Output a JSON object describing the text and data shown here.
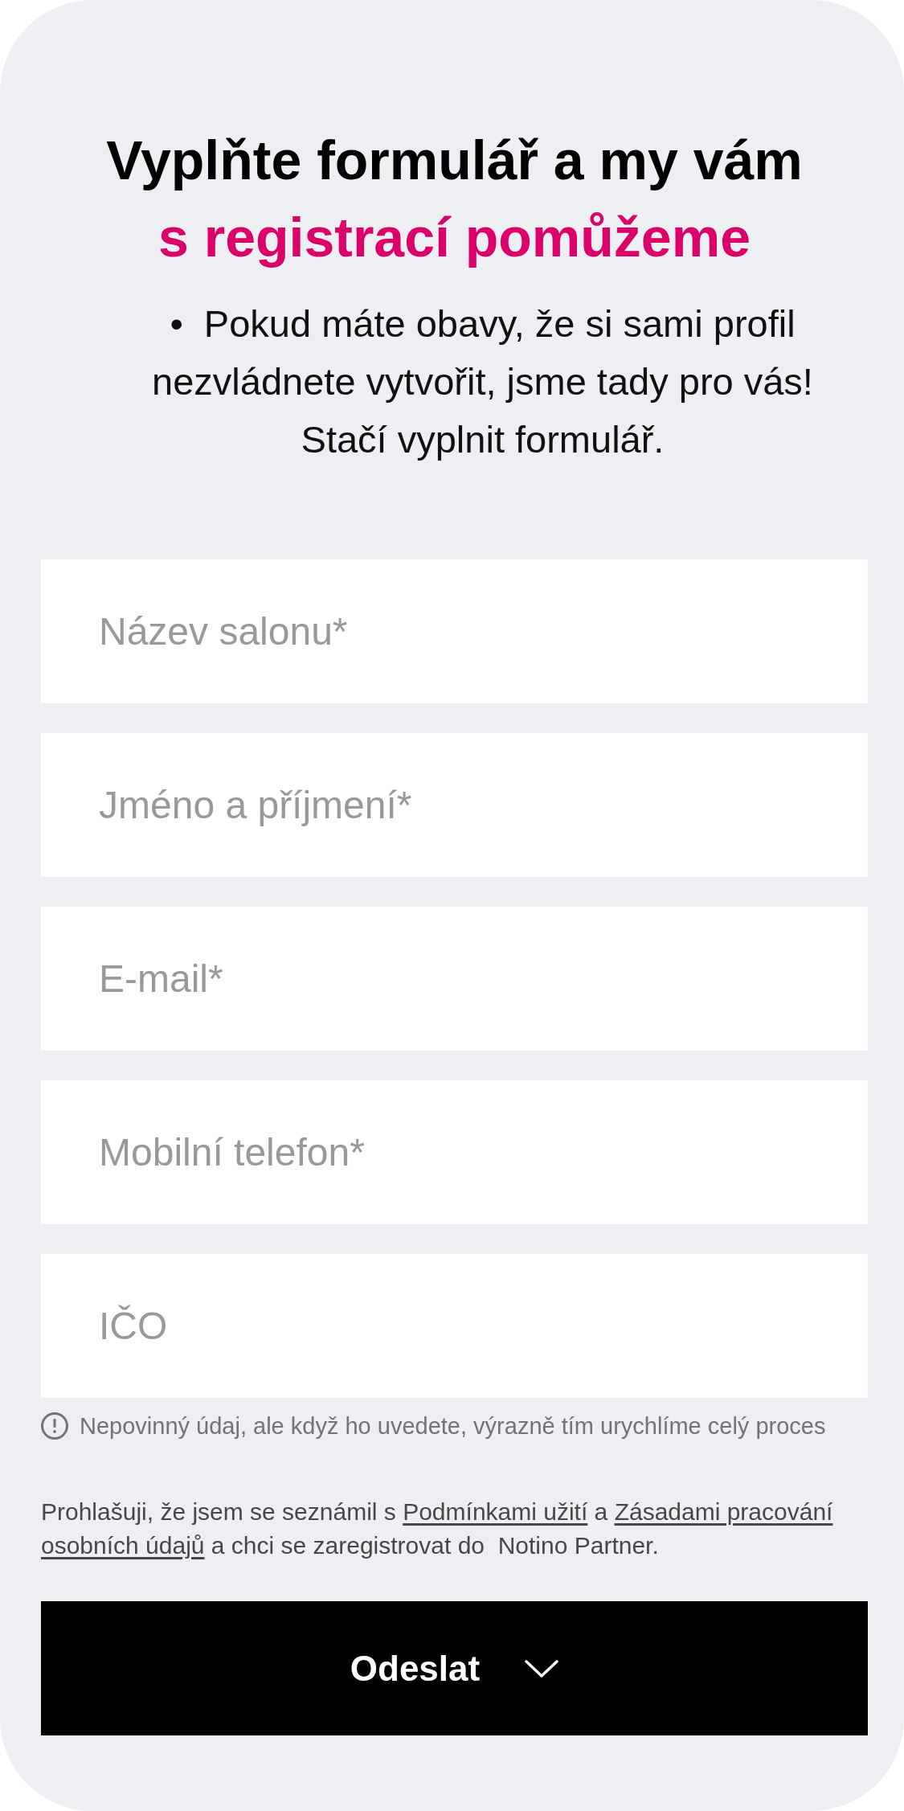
{
  "heading": {
    "text": "Vyplňte formulář a my vám",
    "highlight": "s registrací pomůžeme"
  },
  "intro": {
    "bullet": "•",
    "text": "Pokud máte obavy, že si sami profil nezvládnete vytvořit, jsme tady pro vás! Stačí vyplnit formulář."
  },
  "fields": [
    {
      "placeholder": "Název salonu*"
    },
    {
      "placeholder": "Jméno a příjmení*"
    },
    {
      "placeholder": "E-mail*"
    },
    {
      "placeholder": "Mobilní telefon*"
    },
    {
      "placeholder": "IČO"
    }
  ],
  "note": {
    "text": "Nepovinný údaj, ale když ho uvedete, výrazně tím urychlíme celý proces"
  },
  "consent": {
    "lines": [
      [
        {
          "kind": "text",
          "text": "Prohlašuji, že jsem se seznámil s "
        },
        {
          "kind": "link",
          "text": "Podmínkami užití"
        },
        {
          "kind": "text",
          "text": " a "
        },
        {
          "kind": "link",
          "text": "Zásadami pracování"
        }
      ],
      [
        {
          "kind": "link",
          "text": "osobních údajů"
        },
        {
          "kind": "text",
          "text": " a chci se zaregistrovat do  Notino Partner."
        }
      ]
    ]
  },
  "submit": {
    "label": "Odeslat"
  }
}
